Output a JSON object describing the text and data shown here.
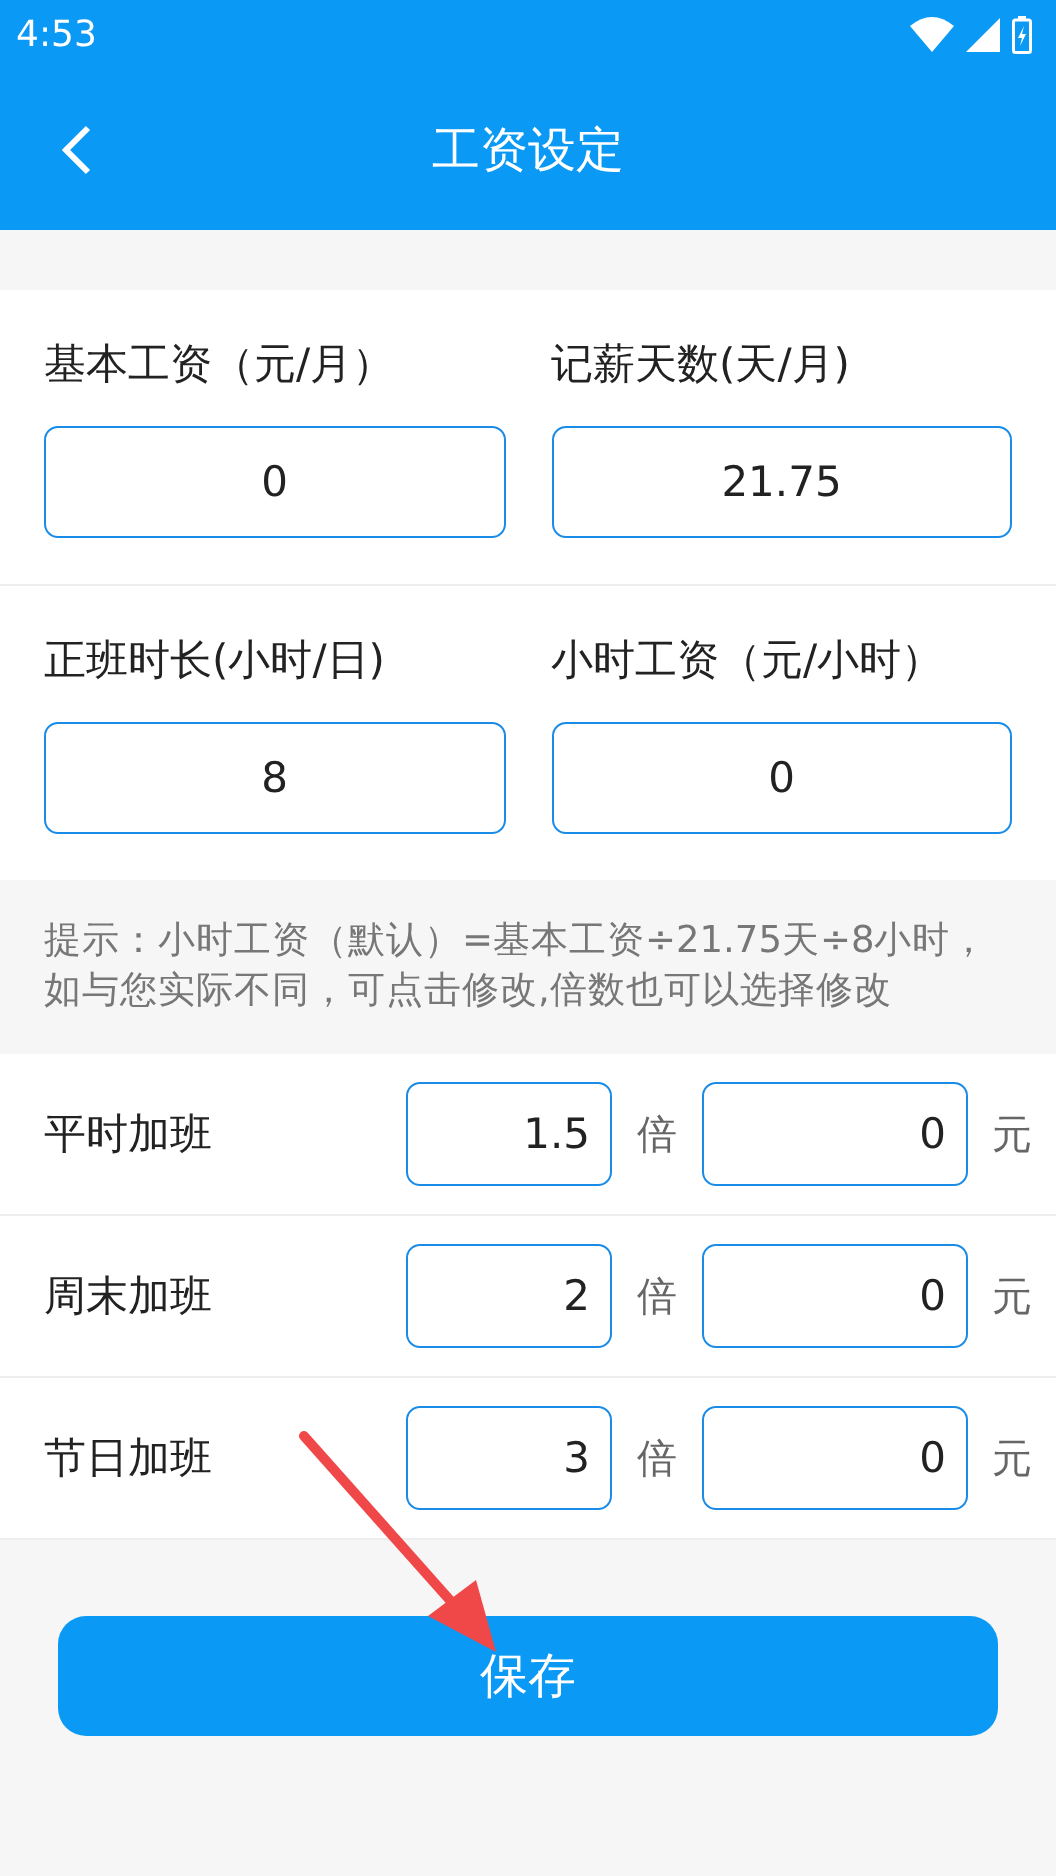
{
  "status_bar": {
    "time": "4:53"
  },
  "header": {
    "title": "工资设定"
  },
  "basic_fields": [
    {
      "label": "基本工资（元/月）",
      "value": "0"
    },
    {
      "label": "记薪天数(天/月)",
      "value": "21.75"
    },
    {
      "label": "正班时长(小时/日)",
      "value": "8"
    },
    {
      "label": "小时工资（元/小时）",
      "value": "0"
    }
  ],
  "hint": "提示：小时工资（默认）=基本工资÷21.75天÷8小时，如与您实际不同，可点击修改,倍数也可以选择修改",
  "overtime": [
    {
      "label": "平时加班",
      "multiplier": "1.5",
      "multiplier_unit": "倍",
      "amount": "0",
      "amount_unit": "元"
    },
    {
      "label": "周末加班",
      "multiplier": "2",
      "multiplier_unit": "倍",
      "amount": "0",
      "amount_unit": "元"
    },
    {
      "label": "节日加班",
      "multiplier": "3",
      "multiplier_unit": "倍",
      "amount": "0",
      "amount_unit": "元"
    }
  ],
  "save_button": "保存"
}
